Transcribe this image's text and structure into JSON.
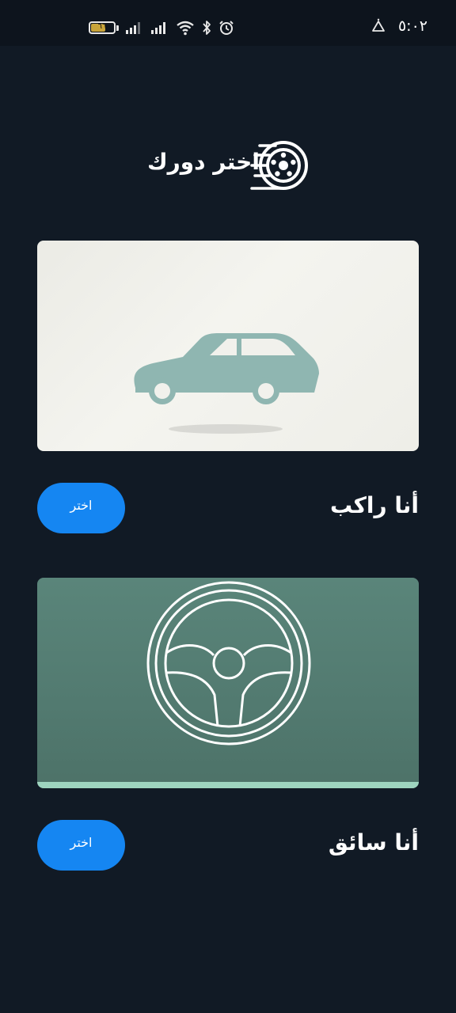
{
  "status_bar": {
    "time": "٥:٠٢",
    "battery_level": "٦٦",
    "battery_fraction": 0.66,
    "icons": [
      "battery-icon",
      "signal-icon",
      "signal-icon",
      "wifi-icon",
      "bluetooth-icon",
      "alarm-icon",
      "warning-icon"
    ]
  },
  "header": {
    "title": "اختر دورك",
    "logo_icon": "tire-icon"
  },
  "roles": [
    {
      "label": "أنا راكب",
      "button_label": "اختر",
      "illustration": "car-icon",
      "card_color": "#f0f0eb",
      "illustration_color": "#8fb6b1"
    },
    {
      "label": "أنا سائق",
      "button_label": "اختر",
      "illustration": "steering-wheel-icon",
      "card_color": "#57806f",
      "illustration_color": "#ffffff"
    }
  ],
  "colors": {
    "background": "#111a25",
    "accent": "#1586f2",
    "driver_stripe": "#9ed4bf"
  }
}
